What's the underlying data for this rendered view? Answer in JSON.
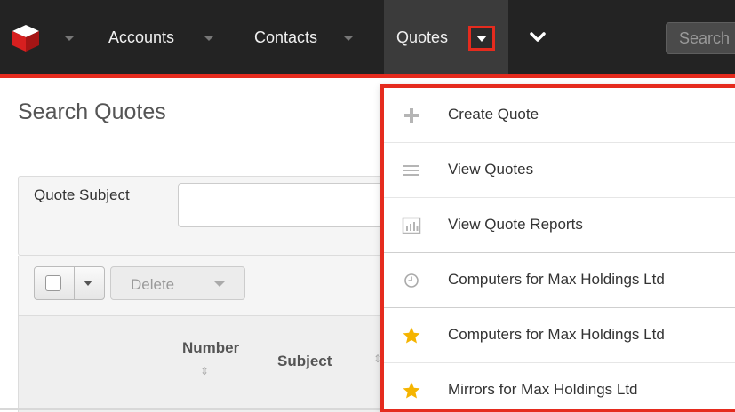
{
  "nav": {
    "items": [
      "Accounts",
      "Contacts",
      "Quotes"
    ],
    "search_placeholder": "Search"
  },
  "page": {
    "title": "Search Quotes",
    "filter_label": "Quote Subject",
    "delete_label": "Delete",
    "columns": [
      "Number",
      "Subject"
    ]
  },
  "menu": {
    "items": [
      {
        "label": "Create Quote",
        "icon": "plus-icon"
      },
      {
        "label": "View Quotes",
        "icon": "list-icon"
      },
      {
        "label": "View Quote Reports",
        "icon": "bar-chart-icon"
      },
      {
        "label": "Computers for Max Holdings Ltd",
        "icon": "clock-icon"
      },
      {
        "label": "Computers for Max Holdings Ltd",
        "icon": "star-icon"
      },
      {
        "label": "Mirrors for Max Holdings Ltd",
        "icon": "star-icon"
      }
    ]
  },
  "colors": {
    "nav_bg": "#232323",
    "accent_red": "#e52b1e",
    "star": "#f5b400"
  }
}
